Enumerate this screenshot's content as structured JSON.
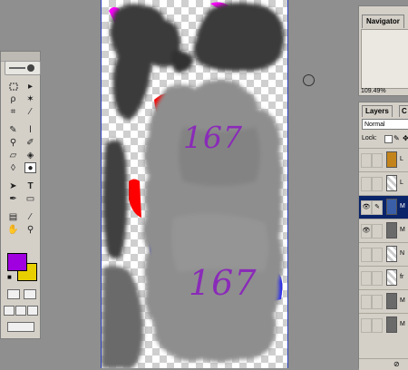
{
  "navigator": {
    "tab_label": "Navigator",
    "zoom": "109.49%"
  },
  "layers": {
    "tab_label": "Layers",
    "tab_more": "C",
    "blend_mode": "Normal",
    "lock_label": "Lock:",
    "rows": [
      {
        "name": "L",
        "thumb": "#c4841c"
      },
      {
        "name": "L",
        "thumb": "checker"
      },
      {
        "name": "M",
        "thumb": "#3a5fa8"
      },
      {
        "name": "M",
        "thumb": "#6a6a6a"
      },
      {
        "name": "N",
        "thumb": "checker"
      },
      {
        "name": "fr",
        "thumb": "checker"
      },
      {
        "name": "M",
        "thumb": "#6a6a6a"
      },
      {
        "name": "M",
        "thumb": "#6a6a6a"
      }
    ]
  },
  "canvas": {
    "label_top": "167",
    "label_bottom": "167"
  },
  "colors": {
    "foreground": "#a000e0",
    "background": "#e8d000",
    "accent_blue": "#2b3fbf",
    "layer_selected": "#0a246a"
  },
  "toolbox": {
    "tools": [
      "marquee-icon",
      "move-icon",
      "lasso-icon",
      "magic-wand-icon",
      "crop-icon",
      "slice-icon",
      "healing-icon",
      "brush-icon",
      "clone-stamp-icon",
      "history-brush-icon",
      "eraser-icon",
      "paint-bucket-icon",
      "blur-icon",
      "dodge-icon",
      "path-select-icon",
      "type-icon",
      "pen-icon",
      "shape-icon",
      "notes-icon",
      "eyedropper-icon",
      "hand-icon",
      "zoom-icon"
    ]
  }
}
